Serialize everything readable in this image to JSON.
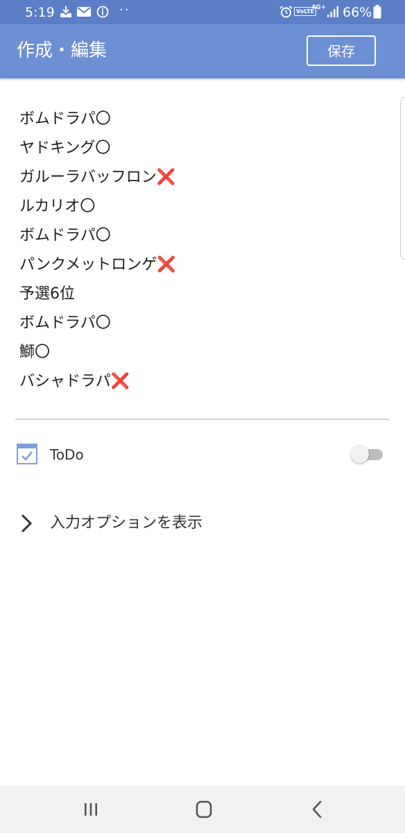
{
  "status_bar": {
    "time": "5:19",
    "volte": "VoLTE",
    "network": "4G+",
    "battery": "66%",
    "icons": [
      "download-icon",
      "mail-icon",
      "info-icon",
      "more-dots",
      "alarm-icon",
      "signal-icon",
      "battery-icon"
    ],
    "dots": "··"
  },
  "app_bar": {
    "title": "作成・編集",
    "save_label": "保存"
  },
  "memo": {
    "lines": [
      {
        "text": "ボムドラパ",
        "mark": "〇",
        "mark_type": "circle"
      },
      {
        "text": "ヤドキング",
        "mark": "〇",
        "mark_type": "circle"
      },
      {
        "text": "ガルーラバッフロン",
        "mark": "❌",
        "mark_type": "cross"
      },
      {
        "text": "ルカリオ",
        "mark": "〇",
        "mark_type": "circle"
      },
      {
        "text": "ボムドラパ",
        "mark": "〇",
        "mark_type": "circle"
      },
      {
        "text": "パンクメットロンゲ",
        "mark": "❌",
        "mark_type": "cross"
      },
      {
        "text": "予選6位",
        "mark": "",
        "mark_type": "none"
      },
      {
        "text": "ボムドラパ",
        "mark": "〇",
        "mark_type": "circle"
      },
      {
        "text": "鰤",
        "mark": "〇",
        "mark_type": "circle"
      },
      {
        "text": "バシャドラパ",
        "mark": "❌",
        "mark_type": "cross"
      }
    ]
  },
  "todo": {
    "label": "ToDo",
    "enabled": false,
    "icon": "calendar-check-icon"
  },
  "options": {
    "label": "入力オプションを表示",
    "icon": "chevron-right-icon"
  },
  "nav": {
    "icons": [
      "recent-apps-icon",
      "home-icon",
      "back-icon"
    ]
  },
  "colors": {
    "status_bar": "#5b7ec6",
    "app_bar": "#6d8fd4",
    "cross": "#e0161b",
    "nav_bar": "#f1f1f1"
  }
}
